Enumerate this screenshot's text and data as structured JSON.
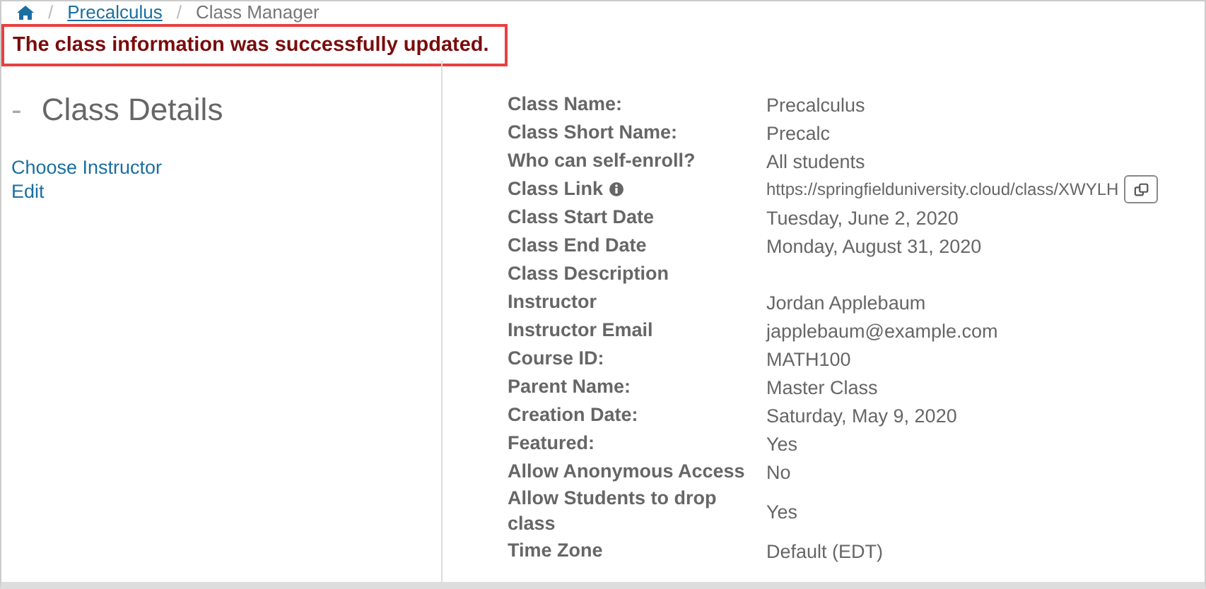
{
  "breadcrumb": [
    "Precalculus",
    "Class Manager"
  ],
  "breadcrumb_separator": "/",
  "alert": "The class information was successfully updated.",
  "sidebar": {
    "title": "Class Details",
    "collapse_glyph": "-",
    "links": [
      "Choose Instructor",
      "Edit"
    ]
  },
  "details": [
    {
      "label": "Class Name:",
      "value": "Precalculus",
      "kind": "text"
    },
    {
      "label": "Class Short Name:",
      "value": "Precalc",
      "kind": "text"
    },
    {
      "label": "Who can self-enroll?",
      "value": "All students",
      "kind": "text"
    },
    {
      "label": "Class Link",
      "value": "https://springfielduniversity.cloud/class/XWYLH",
      "kind": "link"
    },
    {
      "label": "Class Start Date",
      "value": "Tuesday, June 2, 2020",
      "kind": "text"
    },
    {
      "label": "Class End Date",
      "value": "Monday, August 31, 2020",
      "kind": "text"
    },
    {
      "label": "Class Description",
      "kind": "text"
    },
    {
      "label": "Instructor",
      "value": "Jordan Applebaum",
      "kind": "text"
    },
    {
      "label": "Instructor Email",
      "value": "japplebaum@example.com",
      "kind": "text"
    },
    {
      "label": "Course ID:",
      "value": "MATH100",
      "kind": "text"
    },
    {
      "label": "Parent Name:",
      "value": "Master Class",
      "kind": "text"
    },
    {
      "label": "Creation Date:",
      "value": "Saturday, May 9, 2020",
      "kind": "text"
    },
    {
      "label": "Featured:",
      "value": "Yes",
      "kind": "text"
    },
    {
      "label": "Allow Anonymous Access",
      "value": "No",
      "kind": "text"
    },
    {
      "label": "Allow Students to drop class",
      "value": "Yes",
      "kind": "text"
    },
    {
      "label": "Time Zone",
      "value": "Default (EDT)",
      "kind": "text"
    }
  ]
}
